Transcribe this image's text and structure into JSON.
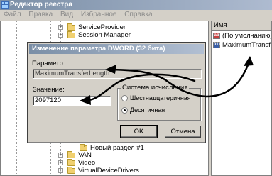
{
  "app": {
    "title": "Редактор реестра"
  },
  "menu": [
    "Файл",
    "Правка",
    "Вид",
    "Избранное",
    "Справка"
  ],
  "tree": {
    "items": [
      {
        "label": "ServiceProvider",
        "expander": "+"
      },
      {
        "label": "Session Manager",
        "expander": "+"
      },
      {
        "label": "Новый раздел #1",
        "expander": ""
      },
      {
        "label": "VAN",
        "expander": "+"
      },
      {
        "label": "Video",
        "expander": "+"
      },
      {
        "label": "VirtualDeviceDrivers",
        "expander": "+"
      }
    ]
  },
  "values": {
    "column_name": "Имя",
    "rows": [
      {
        "name": "(По умолчанию)",
        "icon": "string-value-icon",
        "icon_text": "ab"
      },
      {
        "name": "MaximumTransfe...",
        "icon": "dword-value-icon",
        "icon_text": "011"
      }
    ]
  },
  "dialog": {
    "title": "Изменение параметра DWORD (32 бита)",
    "param_label": "Параметр:",
    "param_value": "MaximumTransferLength",
    "value_label": "Значение:",
    "value_value": "2097120",
    "radix_label": "Система исчисления",
    "radix_options": [
      {
        "label": "Шестнадцатеричная",
        "checked": false
      },
      {
        "label": "Десятичная",
        "checked": true
      }
    ],
    "ok_label": "OK",
    "cancel_label": "Отмена"
  },
  "colors": {
    "titlebar": "#7a8ea6",
    "annotation_arrow": "#000000"
  }
}
